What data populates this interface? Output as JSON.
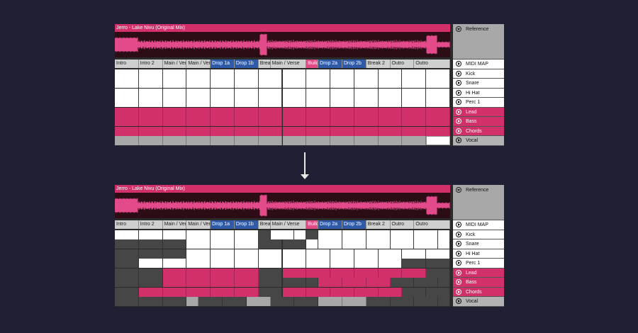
{
  "song_title": "Jerro - Lake Nivu (Original Mix)",
  "reference_label": "Reference",
  "sections": [
    {
      "label": "Intro",
      "color": "gray",
      "span": 1
    },
    {
      "label": "Intro 2",
      "color": "gray",
      "span": 1
    },
    {
      "label": "Main / Verse",
      "color": "gray",
      "span": 1
    },
    {
      "label": "Main / Verse",
      "color": "gray",
      "span": 1
    },
    {
      "label": "Drop 1a",
      "color": "blue",
      "span": 1
    },
    {
      "label": "Drop 1b",
      "color": "blue",
      "span": 1
    },
    {
      "label": "Break",
      "color": "gray",
      "span": 0.5
    },
    {
      "label": "Main / Verse",
      "color": "gray",
      "span": 1.5
    },
    {
      "label": "Build",
      "color": "pink",
      "span": 0.5
    },
    {
      "label": "Drop 2a",
      "color": "blue",
      "span": 1
    },
    {
      "label": "Drop 2b",
      "color": "blue",
      "span": 1
    },
    {
      "label": "Break 2",
      "color": "gray",
      "span": 1
    },
    {
      "label": "Outro",
      "color": "gray",
      "span": 1
    },
    {
      "label": "Outro",
      "color": "gray",
      "span": 1.5
    }
  ],
  "tracks": [
    {
      "name": "MIDI MAP",
      "color": "white"
    },
    {
      "name": "Kick",
      "color": "white"
    },
    {
      "name": "Snare",
      "color": "white"
    },
    {
      "name": "Hi Hat",
      "color": "white"
    },
    {
      "name": "Perc 1",
      "color": "white"
    },
    {
      "name": "Lead",
      "color": "pink"
    },
    {
      "name": "Bass",
      "color": "pink"
    },
    {
      "name": "Chords",
      "color": "pink"
    },
    {
      "name": "Vocal",
      "color": "gray"
    }
  ],
  "before": {
    "rows": [
      [
        [
          "white",
          14
        ]
      ],
      [
        [
          "white",
          14
        ]
      ],
      [
        [
          "white",
          14
        ]
      ],
      [
        [
          "white",
          14
        ]
      ],
      [
        [
          "pink",
          14
        ]
      ],
      [
        [
          "pink",
          14
        ]
      ],
      [
        [
          "pink",
          14
        ]
      ],
      [
        [
          "lgray",
          13
        ],
        [
          "wsel",
          1
        ]
      ]
    ]
  },
  "after": {
    "rows": [
      [
        [
          "white",
          6
        ],
        [
          "empty",
          0.5
        ],
        [
          "white",
          1.5
        ],
        [
          "empty",
          0.5
        ],
        [
          "white",
          5.5
        ]
      ],
      [
        [
          "empty",
          3
        ],
        [
          "white",
          3
        ],
        [
          "empty",
          2
        ],
        [
          "white",
          0.5
        ],
        [
          "white",
          5.5
        ]
      ],
      [
        [
          "empty",
          3
        ],
        [
          "white",
          11
        ]
      ],
      [
        [
          "empty",
          1
        ],
        [
          "white",
          11
        ],
        [
          "empty",
          2
        ]
      ],
      [
        [
          "empty",
          2
        ],
        [
          "pink",
          4
        ],
        [
          "empty",
          1
        ],
        [
          "pink",
          6
        ],
        [
          "empty",
          1
        ]
      ],
      [
        [
          "empty",
          2
        ],
        [
          "pink",
          4
        ],
        [
          "empty",
          2.5
        ],
        [
          "pink",
          3
        ],
        [
          "empty",
          2.5
        ]
      ],
      [
        [
          "empty",
          1
        ],
        [
          "pink",
          5
        ],
        [
          "empty",
          1
        ],
        [
          "pink",
          5
        ],
        [
          "empty",
          2
        ]
      ],
      [
        [
          "empty",
          3
        ],
        [
          "lgray",
          0.5
        ],
        [
          "empty",
          2
        ],
        [
          "lgray",
          1
        ],
        [
          "empty",
          2
        ],
        [
          "lgray",
          2
        ],
        [
          "empty",
          3.5
        ]
      ]
    ]
  },
  "colors": {
    "background": "#1f2033",
    "pink": "#d1306a",
    "blue": "#2f5aa8"
  }
}
